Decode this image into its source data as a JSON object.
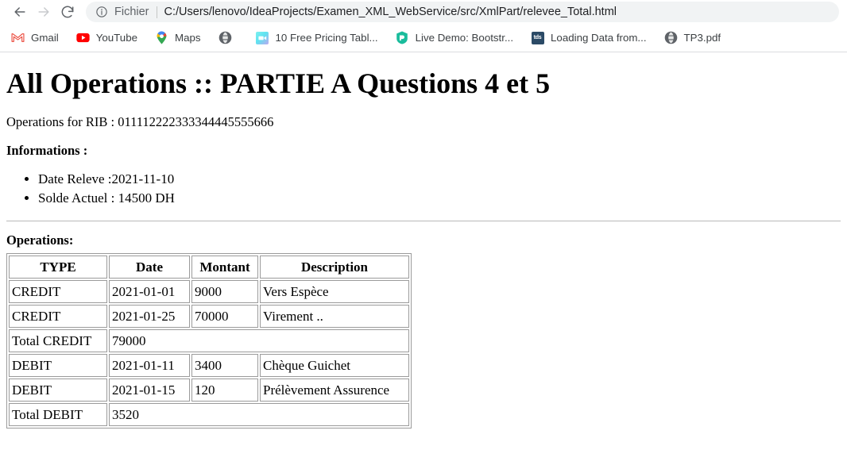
{
  "browser": {
    "nav": {
      "back_label": "Back",
      "forward_label": "Forward",
      "reload_label": "Reload"
    },
    "omnibox": {
      "info_icon": "info-circle-icon",
      "scheme_label": "Fichier",
      "url": "C:/Users/lenovo/IdeaProjects/Examen_XML_WebService/src/XmlPart/relevee_Total.html"
    },
    "bookmarks": [
      {
        "label": "Gmail",
        "icon": "gmail-icon"
      },
      {
        "label": "YouTube",
        "icon": "youtube-icon"
      },
      {
        "label": "Maps",
        "icon": "google-maps-pin-icon"
      },
      {
        "label": "",
        "icon": "globe-icon"
      },
      {
        "label": "10 Free Pricing Tabl...",
        "icon": "cyan-square-favicon"
      },
      {
        "label": "Live Demo: Bootstr...",
        "icon": "green-shield-icon"
      },
      {
        "label": "Loading Data from...",
        "icon": "tds-square-favicon",
        "icon_text": "tds"
      },
      {
        "label": "TP3.pdf",
        "icon": "globe-icon"
      }
    ]
  },
  "page": {
    "title": "All Operations :: PARTIE A Questions 4 et 5",
    "rib_line": "Operations for RIB : 011112222333344445555666",
    "informations_title": "Informations :",
    "info_items": [
      "Date Releve :2021-11-10",
      "Solde Actuel : 14500 DH"
    ],
    "operations_title": "Operations:",
    "table": {
      "headers": [
        "TYPE",
        "Date",
        "Montant",
        "Description"
      ],
      "rows": [
        {
          "type": "CREDIT",
          "date": "2021-01-01",
          "montant": "9000",
          "description": "Vers Espèce",
          "span": false
        },
        {
          "type": "CREDIT",
          "date": "2021-01-25",
          "montant": "70000",
          "description": "Virement ..",
          "span": false
        },
        {
          "type": "Total CREDIT",
          "date": "79000",
          "montant": "",
          "description": "",
          "span": true
        },
        {
          "type": "DEBIT",
          "date": "2021-01-11",
          "montant": "3400",
          "description": "Chèque Guichet",
          "span": false
        },
        {
          "type": "DEBIT",
          "date": "2021-01-15",
          "montant": "120",
          "description": "Prélèvement Assurence",
          "span": false
        },
        {
          "type": "Total DEBIT",
          "date": "3520",
          "montant": "",
          "description": "",
          "span": true
        }
      ]
    }
  },
  "colors": {
    "omnibox_bg": "#f1f3f4",
    "text": "#202124",
    "muted_text": "#5f6368",
    "border": "#dadce0",
    "table_border": "#9b9b9b",
    "gmail_red": "#ea4335",
    "youtube_red": "#ff0000",
    "tds_navy": "#2b4a66",
    "bootstrap_green": "#1abc9c"
  }
}
